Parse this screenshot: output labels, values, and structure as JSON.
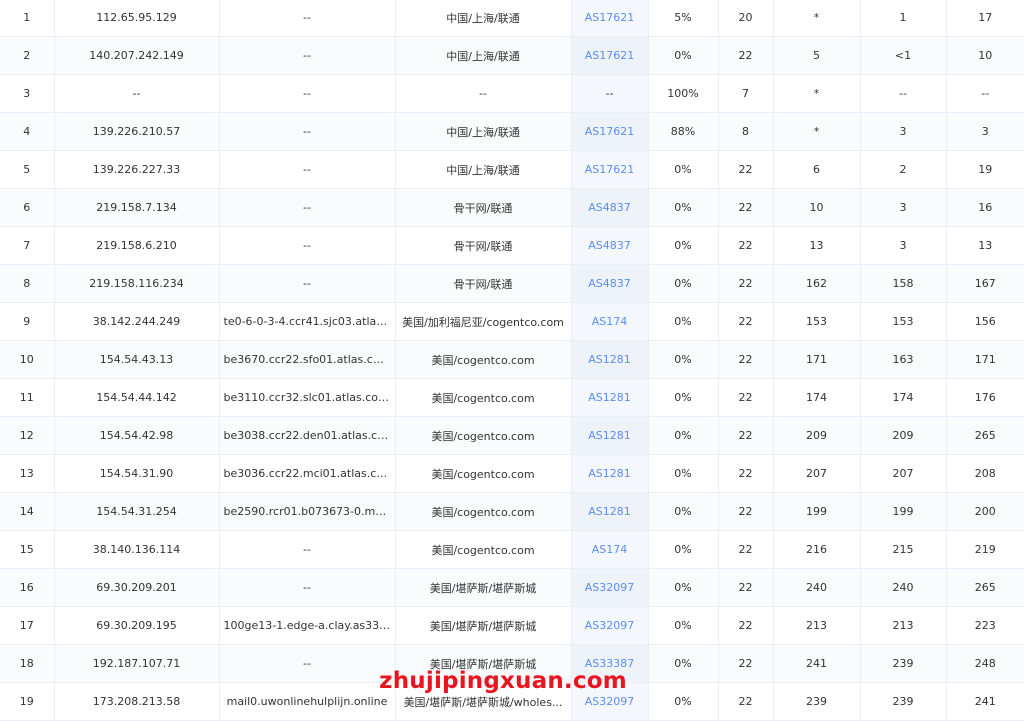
{
  "colors": {
    "asn_link": "#5b8def",
    "watermark": "#e8151f",
    "row_border": "#ebeef5",
    "asn_cell_bg": "#f4f7fc"
  },
  "hops": [
    {
      "hop": "1",
      "ip": "112.65.95.129",
      "hostname": "--",
      "location": "中国/上海/联通",
      "asn": "AS17621",
      "loss": "5%",
      "sent": "20",
      "last": "*",
      "best": "1",
      "worst": "17"
    },
    {
      "hop": "2",
      "ip": "140.207.242.149",
      "hostname": "--",
      "location": "中国/上海/联通",
      "asn": "AS17621",
      "loss": "0%",
      "sent": "22",
      "last": "5",
      "best": "<1",
      "worst": "10"
    },
    {
      "hop": "3",
      "ip": "--",
      "hostname": "--",
      "location": "--",
      "asn": "--",
      "loss": "100%",
      "sent": "7",
      "last": "*",
      "best": "--",
      "worst": "--"
    },
    {
      "hop": "4",
      "ip": "139.226.210.57",
      "hostname": "--",
      "location": "中国/上海/联通",
      "asn": "AS17621",
      "loss": "88%",
      "sent": "8",
      "last": "*",
      "best": "3",
      "worst": "3"
    },
    {
      "hop": "5",
      "ip": "139.226.227.33",
      "hostname": "--",
      "location": "中国/上海/联通",
      "asn": "AS17621",
      "loss": "0%",
      "sent": "22",
      "last": "6",
      "best": "2",
      "worst": "19"
    },
    {
      "hop": "6",
      "ip": "219.158.7.134",
      "hostname": "--",
      "location": "骨干网/联通",
      "asn": "AS4837",
      "loss": "0%",
      "sent": "22",
      "last": "10",
      "best": "3",
      "worst": "16"
    },
    {
      "hop": "7",
      "ip": "219.158.6.210",
      "hostname": "--",
      "location": "骨干网/联通",
      "asn": "AS4837",
      "loss": "0%",
      "sent": "22",
      "last": "13",
      "best": "3",
      "worst": "13"
    },
    {
      "hop": "8",
      "ip": "219.158.116.234",
      "hostname": "--",
      "location": "骨干网/联通",
      "asn": "AS4837",
      "loss": "0%",
      "sent": "22",
      "last": "162",
      "best": "158",
      "worst": "167"
    },
    {
      "hop": "9",
      "ip": "38.142.244.249",
      "hostname": "te0-6-0-3-4.ccr41.sjc03.atlas....",
      "location": "美国/加利福尼亚/cogentco.com",
      "asn": "AS174",
      "loss": "0%",
      "sent": "22",
      "last": "153",
      "best": "153",
      "worst": "156"
    },
    {
      "hop": "10",
      "ip": "154.54.43.13",
      "hostname": "be3670.ccr22.sfo01.atlas.cog...",
      "location": "美国/cogentco.com",
      "asn": "AS1281",
      "loss": "0%",
      "sent": "22",
      "last": "171",
      "best": "163",
      "worst": "171"
    },
    {
      "hop": "11",
      "ip": "154.54.44.142",
      "hostname": "be3110.ccr32.slc01.atlas.cog...",
      "location": "美国/cogentco.com",
      "asn": "AS1281",
      "loss": "0%",
      "sent": "22",
      "last": "174",
      "best": "174",
      "worst": "176"
    },
    {
      "hop": "12",
      "ip": "154.54.42.98",
      "hostname": "be3038.ccr22.den01.atlas.co...",
      "location": "美国/cogentco.com",
      "asn": "AS1281",
      "loss": "0%",
      "sent": "22",
      "last": "209",
      "best": "209",
      "worst": "265"
    },
    {
      "hop": "13",
      "ip": "154.54.31.90",
      "hostname": "be3036.ccr22.mci01.atlas.co...",
      "location": "美国/cogentco.com",
      "asn": "AS1281",
      "loss": "0%",
      "sent": "22",
      "last": "207",
      "best": "207",
      "worst": "208"
    },
    {
      "hop": "14",
      "ip": "154.54.31.254",
      "hostname": "be2590.rcr01.b073673-0.mci...",
      "location": "美国/cogentco.com",
      "asn": "AS1281",
      "loss": "0%",
      "sent": "22",
      "last": "199",
      "best": "199",
      "worst": "200"
    },
    {
      "hop": "15",
      "ip": "38.140.136.114",
      "hostname": "--",
      "location": "美国/cogentco.com",
      "asn": "AS174",
      "loss": "0%",
      "sent": "22",
      "last": "216",
      "best": "215",
      "worst": "219"
    },
    {
      "hop": "16",
      "ip": "69.30.209.201",
      "hostname": "--",
      "location": "美国/堪萨斯/堪萨斯城",
      "asn": "AS32097",
      "loss": "0%",
      "sent": "22",
      "last": "240",
      "best": "240",
      "worst": "265"
    },
    {
      "hop": "17",
      "ip": "69.30.209.195",
      "hostname": "100ge13-1.edge-a.clay.as333...",
      "location": "美国/堪萨斯/堪萨斯城",
      "asn": "AS32097",
      "loss": "0%",
      "sent": "22",
      "last": "213",
      "best": "213",
      "worst": "223"
    },
    {
      "hop": "18",
      "ip": "192.187.107.71",
      "hostname": "--",
      "location": "美国/堪萨斯/堪萨斯城",
      "asn": "AS33387",
      "loss": "0%",
      "sent": "22",
      "last": "241",
      "best": "239",
      "worst": "248"
    },
    {
      "hop": "19",
      "ip": "173.208.213.58",
      "hostname": "mail0.uwonlinehulplijn.online",
      "location": "美国/堪萨斯/堪萨斯城/wholes...",
      "asn": "AS32097",
      "loss": "0%",
      "sent": "22",
      "last": "239",
      "best": "239",
      "worst": "241"
    }
  ],
  "watermark": {
    "text": "zhujipingxuan.com"
  }
}
